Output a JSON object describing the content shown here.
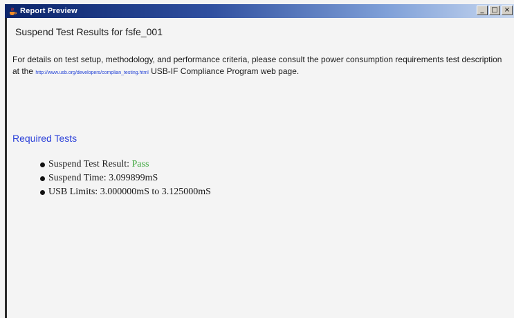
{
  "window": {
    "title": "Report Preview",
    "icon": "java-cup-icon",
    "controls": {
      "minimize": "_",
      "maximize": "□",
      "close": "×"
    }
  },
  "report": {
    "heading": "Suspend Test Results for fsfe_001",
    "intro_before_link": "For details on test setup, methodology, and performance criteria, please consult the power consumption requirements test description at the ",
    "link_text": "http://www.usb.org/developers/complian_testing.html",
    "intro_after_link": " USB-IF Compliance Program web page.",
    "section_title": "Required Tests",
    "results": [
      {
        "label": "Suspend Test Result: ",
        "value": "Pass"
      },
      {
        "label": "Suspend Time: ",
        "value": "3.099899mS"
      },
      {
        "label": "USB Limits: ",
        "value": "3.000000mS to 3.125000mS"
      }
    ]
  },
  "colors": {
    "pass": "#3aa53a",
    "link": "#1f3fd6",
    "section_title": "#2a3fd9",
    "titlebar_start": "#0a246a",
    "titlebar_end": "#c8d8f0"
  }
}
